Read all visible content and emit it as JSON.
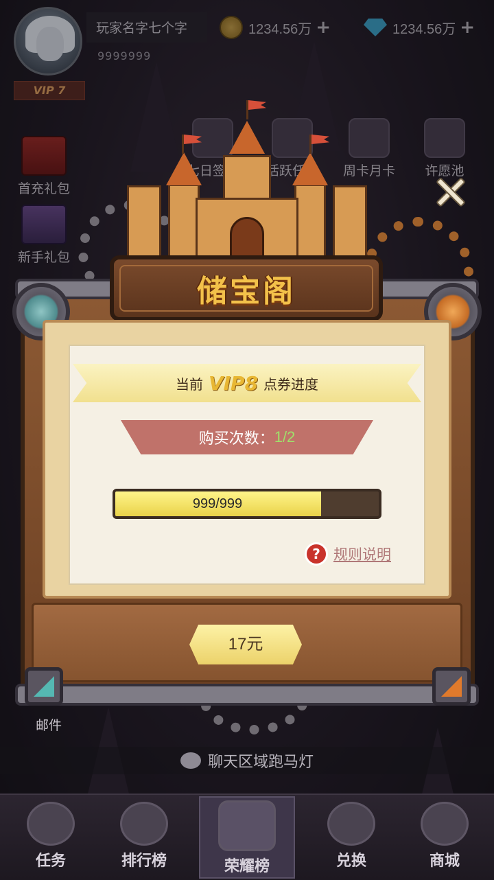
{
  "header": {
    "player_name": "玩家名字七个字",
    "player_id": "9999999",
    "vip_level": "VIP 7",
    "gold": {
      "icon": "gold-coin-icon",
      "value": "1234.56万",
      "add": "+"
    },
    "diamond": {
      "icon": "diamond-icon",
      "value": "1234.56万",
      "add": "+"
    }
  },
  "side_menu": {
    "first_recharge": "首充礼包",
    "new_gift": "新手礼包"
  },
  "top_menu": [
    {
      "label": "七日签到"
    },
    {
      "label": "活跃任务"
    },
    {
      "label": "周卡月卡"
    },
    {
      "label": "许愿池"
    }
  ],
  "modal": {
    "title": "储宝阁",
    "ribbon_prefix": "当前",
    "ribbon_vip": "VIP8",
    "ribbon_suffix": "点券进度",
    "purchase_label": "购买次数：",
    "purchase_value": "1/2",
    "progress_text": "999/999",
    "progress_fraction": 0.78,
    "rules_label": "规则说明",
    "help_symbol": "?",
    "price_label": "17元"
  },
  "bottom": {
    "mail_label": "邮件",
    "marquee_text": "聊天区域跑马灯"
  },
  "nav": [
    {
      "label": "任务",
      "icon": "task-flame-icon"
    },
    {
      "label": "排行榜",
      "icon": "ranking-crown-icon"
    },
    {
      "label": "荣耀榜",
      "icon": "honor-shield-icon"
    },
    {
      "label": "兑换",
      "icon": "exchange-gift-icon"
    },
    {
      "label": "商城",
      "icon": "shop-icon"
    }
  ],
  "colors": {
    "accent_gold": "#f3c14a",
    "progress_fill": "#e9d34a",
    "purchase_value": "#9fe06a",
    "banner": "#c0726a"
  }
}
